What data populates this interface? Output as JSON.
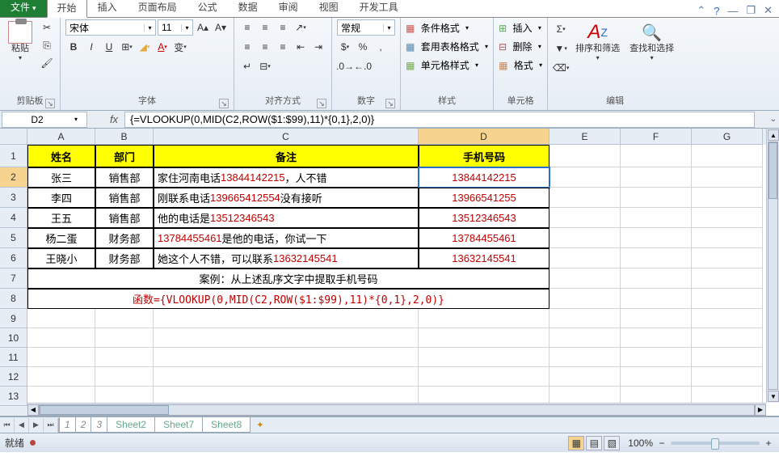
{
  "tabs": {
    "file": "文件",
    "start": "开始",
    "insert": "插入",
    "page_layout": "页面布局",
    "formulas": "公式",
    "data": "数据",
    "review": "审阅",
    "view": "视图",
    "dev": "开发工具"
  },
  "ribbon": {
    "clipboard": {
      "label": "剪贴板",
      "paste": "粘贴"
    },
    "font": {
      "label": "字体",
      "family": "宋体",
      "size": "11",
      "bold": "B",
      "italic": "I",
      "underline": "U"
    },
    "alignment": {
      "label": "对齐方式"
    },
    "number": {
      "label": "数字",
      "format": "常规"
    },
    "styles": {
      "label": "样式",
      "cond_fmt": "条件格式",
      "tbl_fmt": "套用表格格式",
      "cell_style": "单元格样式"
    },
    "cells": {
      "label": "单元格",
      "insert": "插入",
      "delete": "删除",
      "format": "格式"
    },
    "editing": {
      "label": "编辑",
      "sort": "排序和筛选",
      "find": "查找和选择"
    }
  },
  "formula_bar": {
    "cell_ref": "D2",
    "formula": "{=VLOOKUP(0,MID(C2,ROW($1:$99),11)*{0,1},2,0)}"
  },
  "columns": {
    "A": 84,
    "B": 72,
    "C": 328,
    "D": 162,
    "E": 88,
    "F": 88,
    "G": 88
  },
  "row_heights": {
    "header": 28,
    "data": 25,
    "empty": 24
  },
  "headers": {
    "A": "姓名",
    "B": "部门",
    "C": "备注",
    "D": "手机号码"
  },
  "rows": [
    {
      "name": "张三",
      "dept": "销售部",
      "note_pre": "家住河南电话",
      "phone": "13844142215",
      "note_post": "，人不错",
      "extracted": "13844142215"
    },
    {
      "name": "李四",
      "dept": "销售部",
      "note_pre": "刚联系电话",
      "phone": "139665412554",
      "note_post": "没有接听",
      "extracted": "13966541255"
    },
    {
      "name": "王五",
      "dept": "销售部",
      "note_pre": "他的电话是",
      "phone": "13512346543",
      "note_post": "",
      "extracted": "13512346543"
    },
    {
      "name": "杨二蛋",
      "dept": "财务部",
      "note_pre": "",
      "phone": "13784455461",
      "note_post": "是他的电话，你试一下",
      "extracted": "13784455461"
    },
    {
      "name": "王晓小",
      "dept": "财务部",
      "note_pre": "她这个人不错，可以联系",
      "phone": "13632145541",
      "note_post": "",
      "extracted": "13632145541"
    }
  ],
  "case_label": "案例：从上述乱序文字中提取手机号码",
  "formula_label": "函数={VLOOKUP(0,MID(C2,ROW($1:$99),11)*{0,1},2,0)}",
  "sheets": [
    "1",
    "2",
    "3",
    "Sheet2",
    "Sheet7",
    "Sheet8"
  ],
  "status": {
    "ready": "就绪",
    "zoom": "100%"
  }
}
